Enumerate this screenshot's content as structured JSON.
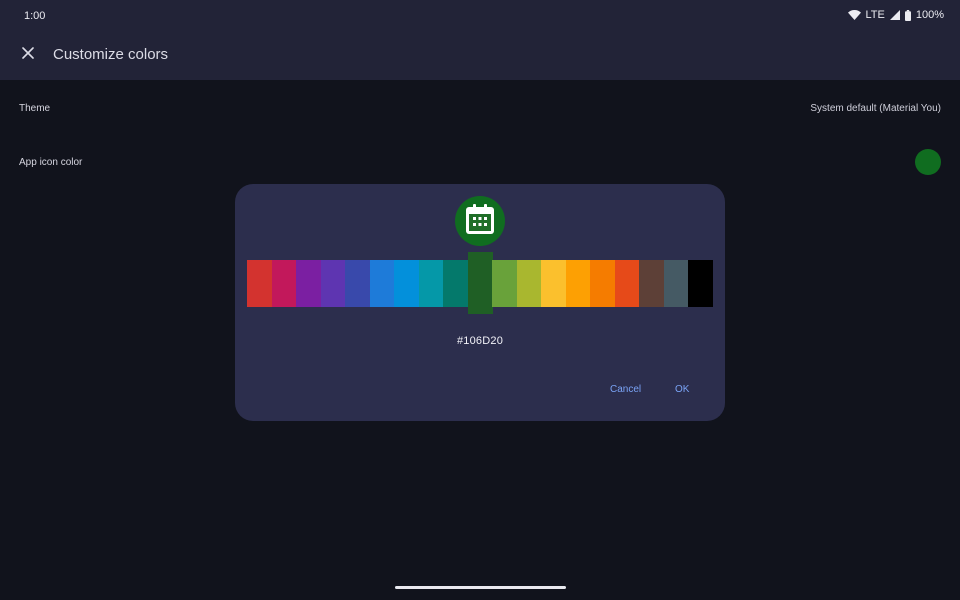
{
  "status_bar": {
    "time": "1:00",
    "network": "LTE",
    "battery": "100%",
    "icons": [
      "wifi-icon",
      "cell-signal-icon",
      "battery-icon"
    ]
  },
  "app_bar": {
    "close_icon": "close-icon",
    "title": "Customize colors"
  },
  "settings": {
    "theme_label": "Theme",
    "theme_value": "System default (Material You)",
    "app_icon_color_label": "App icon color",
    "app_icon_color": "#106D20"
  },
  "dialog": {
    "preview_icon": "calendar-icon",
    "selected_color": "#106D20",
    "selected_index": 9,
    "palette": [
      "#d3332f",
      "#c2185b",
      "#7b1fa2",
      "#5e35b1",
      "#3949ab",
      "#1e7bd9",
      "#0390db",
      "#0598a8",
      "#04796b",
      "#1f5f25",
      "#69a23a",
      "#a9b72f",
      "#fbc02d",
      "#fda003",
      "#f57c00",
      "#e64a19",
      "#5d4037",
      "#455a64",
      "#000000"
    ],
    "hex_text": "#106D20",
    "cancel_label": "Cancel",
    "ok_label": "OK"
  },
  "colors": {
    "background": "#11131c",
    "bar": "#222337",
    "dialog": "#2c2e4d",
    "accent": "#7aa3f5"
  }
}
